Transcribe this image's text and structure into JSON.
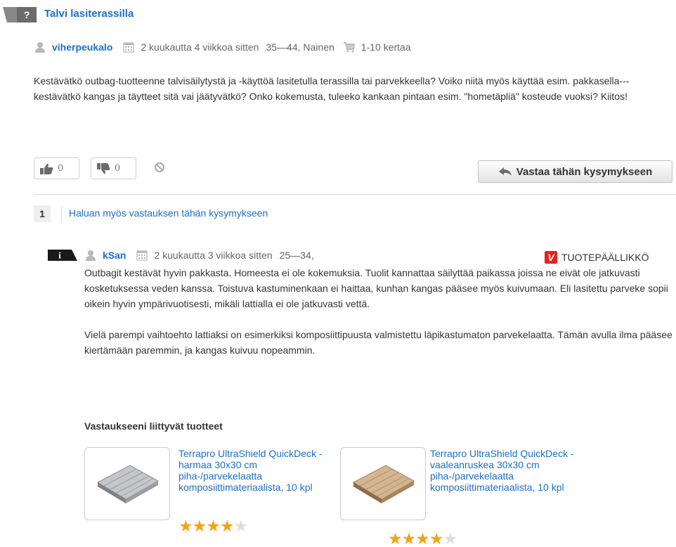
{
  "question": {
    "badge": "?",
    "title": "Talvi lasiterassilla",
    "user": "viherpeukalo",
    "date": "2 kuukautta 4 viikkoa sitten",
    "demographics": "35—44, Nainen",
    "purchases": "1-10 kertaa",
    "body": "Kestävätkö outbag-tuotteenne talvisäilytystä ja -käyttöä lasitetulla terassilla tai parvekkeella? Voiko niitä myös käyttää esim. pakkasella---kestävätkö kangas ja täytteet sitä vai jäätyvätkö? Onko kokemusta, tuleeko kankaan pintaan esim. \"hometäpliä\" kosteude vuoksi? Kiitos!",
    "votes_up": "0",
    "votes_down": "0",
    "answer_button": "Vastaa tähän kysymykseen"
  },
  "want_answer": {
    "count": "1",
    "label": "Haluan myös vastauksen tähän kysymykseen"
  },
  "answer": {
    "badge": "i",
    "user": "kSan",
    "date": "2 kuukautta 3 viikkoa sitten",
    "demographics": "25—34,",
    "role_logo": "V",
    "role": "TUOTEPÄÄLLIKKÖ",
    "paragraph1": "Outbagit kestävät hyvin pakkasta. Homeesta ei ole kokemuksia. Tuolit kannattaa säilyttää paikassa joissa ne eivät ole jatkuvasti kosketuksessa veden kanssa. Toistuva kastuminenkaan ei haittaa, kunhan kangas pääsee myös kuivumaan. Eli lasitettu parveke sopii oikein hyvin ympärivuotisesti, mikäli lattialla ei ole jatkuvasti vettä.",
    "paragraph2": "Vielä parempi vaihtoehto lattiaksi on esimerkiksi komposiittipuusta valmistettu läpikastumaton parvekelaatta. Tämän avulla ilma pääsee kiertämään paremmin, ja kangas kuivuu nopeammin."
  },
  "related": {
    "title": "Vastaukseeni liittyvät tuotteet",
    "products": [
      {
        "name": "Terrapro UltraShield QuickDeck - harmaa 30x30 cm piha-/parvekelaatta komposiittimateriaalista, 10 kpl",
        "rating": 4,
        "max": 5,
        "color": "#b9bcbf"
      },
      {
        "name": "Terrapro UltraShield QuickDeck - vaaleanruskea 30x30 cm piha-/parvekelaatta komposiittimateriaalista, 10 kpl",
        "rating": 4,
        "max": 5,
        "color": "#c9a783"
      }
    ]
  },
  "colors": {
    "link": "#1a6fc9",
    "brand_red": "#e8221b",
    "star": "#f5a313"
  }
}
